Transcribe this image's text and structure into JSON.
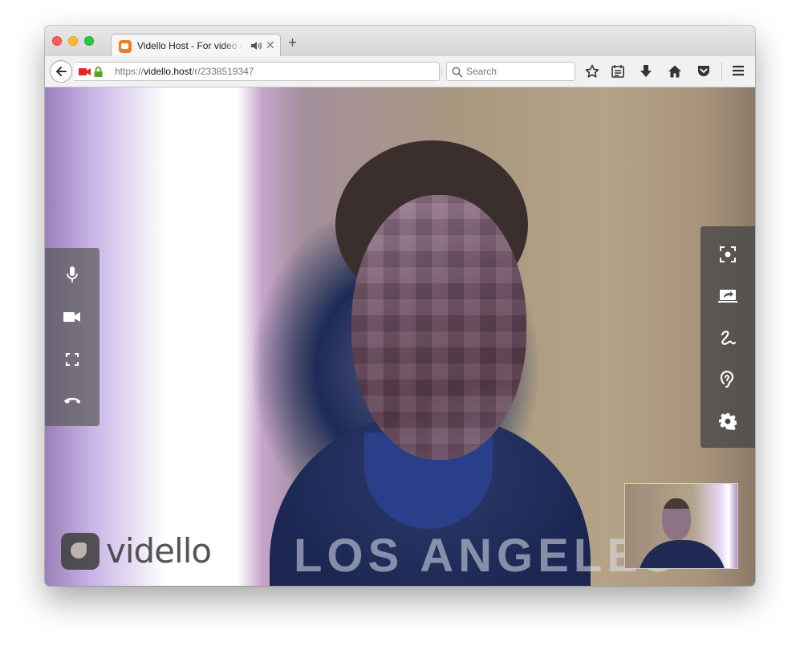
{
  "browser": {
    "tab": {
      "title": "Vidello Host - For video m",
      "audio_icon": "speaker-icon",
      "close_icon": "close-icon"
    },
    "new_tab_label": "+",
    "url": {
      "scheme": "https://",
      "domain": "vidello.host",
      "path": "/r/2338519347"
    },
    "search": {
      "placeholder": "Search"
    },
    "toolbar_icons": [
      "star-icon",
      "reading-list-icon",
      "download-icon",
      "home-icon",
      "pocket-icon",
      "menu-icon"
    ]
  },
  "call": {
    "left_controls": [
      "microphone-icon",
      "camera-icon",
      "fullscreen-icon",
      "hang-up-icon"
    ],
    "right_controls": [
      "snapshot-icon",
      "screen-share-icon",
      "draw-icon",
      "hearing-icon",
      "settings-icon"
    ],
    "logo_text": "vidello",
    "shirt_text": "LOS ANGELES"
  },
  "colors": {
    "brand_orange": "#f27d1e",
    "panel_bg": "#5a5a5a",
    "camera_red": "#e0281e",
    "lock_green": "#57a51c"
  }
}
